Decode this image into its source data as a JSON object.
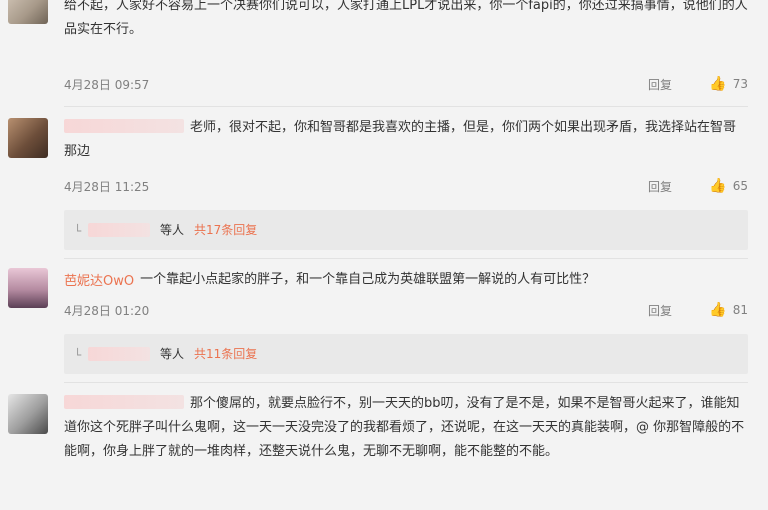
{
  "comments": [
    {
      "text": "给不起，人家好不容易上一个决赛你们说可以，人家打通上LPL才说出来，你一个fapi的，你还过来搞事情，说他们的人品实在不行。",
      "date": "4月28日 09:57",
      "reply_label": "回复",
      "likes": "73"
    },
    {
      "text": "老师，很对不起，你和智哥都是我喜欢的主播，但是，你们两个如果出现矛盾，我选择站在智哥那边",
      "date": "4月28日 11:25",
      "reply_label": "回复",
      "likes": "65",
      "sub_reply": {
        "etc": "等人",
        "more": "共17条回复"
      }
    },
    {
      "username": "芭妮达OwO",
      "text": "一个靠起小点起家的胖子，和一个靠自己成为英雄联盟第一解说的人有可比性？",
      "date": "4月28日 01:20",
      "reply_label": "回复",
      "likes": "81",
      "sub_reply": {
        "etc": "等人",
        "more": "共11条回复"
      }
    },
    {
      "text": "那个傻屌的，就要点脸行不，别一天天的bb叨，没有了是不是，如果不是智哥火起来了，谁能知道你这个死胖子叫什么鬼啊，这一天一天没完没了的我都看烦了，还说呢，在这一天天的真能装啊，@ 你那智障般的不能啊，你身上胖了就的一堆肉样，还整天说什么鬼，无聊不无聊啊，能不能整的不能。",
      "date": "",
      "reply_label": "",
      "likes": ""
    }
  ],
  "icons": {
    "like": "thumbs-up-icon",
    "reply_corner": "corner-arrow-icon"
  },
  "colors": {
    "username": "#eb7350",
    "meta": "#808080",
    "subreply_bg": "#e9e9e9"
  }
}
